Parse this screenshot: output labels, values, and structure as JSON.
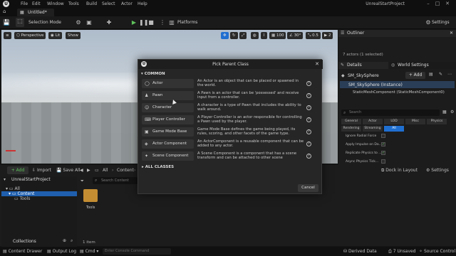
{
  "menubar": {
    "items": [
      "File",
      "Edit",
      "Window",
      "Tools",
      "Build",
      "Select",
      "Actor",
      "Help"
    ],
    "project_name": "UnrealStartProject"
  },
  "tab": {
    "label": "Untitled*"
  },
  "toolbar": {
    "selection_mode": "Selection Mode",
    "platforms": "Platforms",
    "settings": "Settings"
  },
  "viewport": {
    "perspective": "Perspective",
    "lit": "Lit",
    "show": "Show",
    "grid_value": "100",
    "angle_value": "30°",
    "scale_value": "0.5",
    "camera_value": "2"
  },
  "outliner": {
    "title": "Outliner",
    "count": "7 actors (1 selected)"
  },
  "details": {
    "tab_details": "Details",
    "tab_world": "World Settings",
    "actor_name": "SM_SkySphere",
    "add_label": "+ Add",
    "instance": "SM_SkySphere (Instance)",
    "component": "StaticMeshComponent (StaticMeshComponent0)",
    "search_placeholder": "Search",
    "filters_row1": [
      "General",
      "Actor",
      "LOD",
      "Misc",
      "Physics"
    ],
    "filters_row2": [
      "Rendering",
      "Streaming",
      "All"
    ],
    "props": [
      "Ignore Radial Force",
      "Apply Impulse on Da...",
      "Replicate Physics to ...",
      "Async Physics Tick..."
    ]
  },
  "content_browser": {
    "add": "+ Add",
    "import": "Import",
    "save_all": "Save All",
    "path_all": "All",
    "path_content": "Content",
    "project": "UnrealStartProject",
    "tree_all": "All",
    "tree_content": "Content",
    "tree_tools": "Tools",
    "search_placeholder": "Search Content",
    "folder_label": "Tools",
    "collections": "Collections",
    "item_count": "1 item",
    "dock_in_layout": "Dock in Layout",
    "settings": "Settings"
  },
  "statusbar": {
    "content_drawer": "Content Drawer",
    "output_log": "Output Log",
    "cmd": "Cmd",
    "console_placeholder": "Enter Console Command",
    "derived_data": "Derived Data",
    "unsaved": "7 Unsaved",
    "source_control": "Source Control"
  },
  "dialog": {
    "title": "Pick Parent Class",
    "common": "COMMON",
    "all_classes": "ALL CLASSES",
    "cancel": "Cancel",
    "classes": [
      {
        "name": "Actor",
        "desc": "An Actor is an object that can be placed or spawned in the world."
      },
      {
        "name": "Pawn",
        "desc": "A Pawn is an actor that can be 'possessed' and receive input from a controller."
      },
      {
        "name": "Character",
        "desc": "A character is a type of Pawn that includes the ability to walk around."
      },
      {
        "name": "Player Controller",
        "desc": "A Player Controller is an actor responsible for controlling a Pawn used by the player."
      },
      {
        "name": "Game Mode Base",
        "desc": "Game Mode Base defines the game being played, its rules, scoring, and other facets of the game type."
      },
      {
        "name": "Actor Component",
        "desc": "An ActorComponent is a reusable component that can be added to any actor."
      },
      {
        "name": "Scene Component",
        "desc": "A Scene Component is a component that has a scene transform and can be attached to other scene"
      }
    ]
  },
  "colors": {
    "accent_green": "#5ec15b",
    "accent_blue": "#1f6fd1",
    "panel": "#1c1c1c"
  }
}
